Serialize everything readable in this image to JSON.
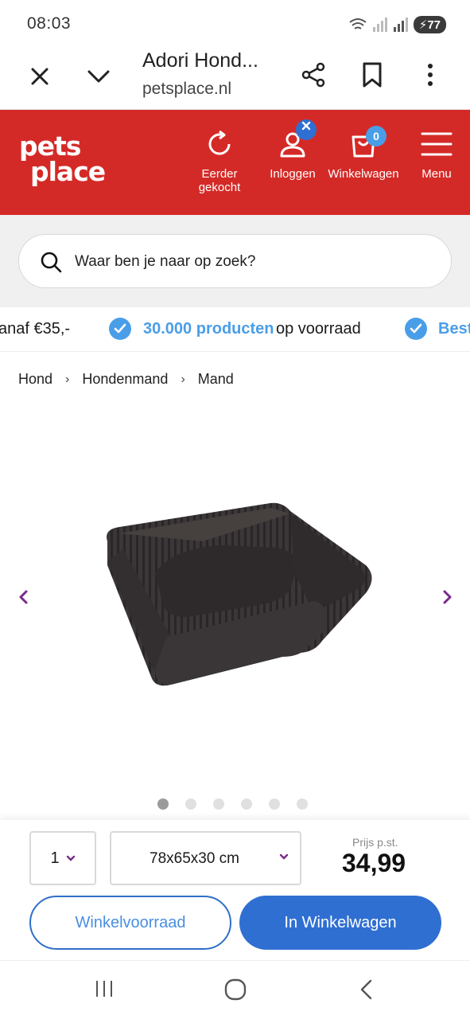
{
  "status_bar": {
    "time": "08:03",
    "battery": "77"
  },
  "browser": {
    "title": "Adori Hond...",
    "url": "petsplace.nl",
    "icons": [
      "close-icon",
      "chevron-down-icon",
      "share-icon",
      "bookmark-icon",
      "more-vertical-icon"
    ]
  },
  "header": {
    "logo_line1": "pets",
    "logo_line2": "place",
    "items": [
      {
        "label": "Eerder gekocht",
        "icon": "refresh-icon"
      },
      {
        "label": "Inloggen",
        "icon": "user-icon"
      },
      {
        "label": "Winkelwagen",
        "icon": "cart-icon"
      },
      {
        "label": "Menu",
        "icon": "hamburger-icon"
      }
    ],
    "cart_count": "0",
    "colors": {
      "brand": "#d42a27",
      "accent": "#4a9ee8"
    }
  },
  "search": {
    "placeholder": "Waar ben je naar op zoek?"
  },
  "usp": {
    "item1_tail": "anaf €35,-",
    "item2_highlight": "30.000 producten",
    "item2_rest": "op voorraad",
    "item3_partial": "Best"
  },
  "breadcrumb": [
    "Hond",
    "Hondenmand",
    "Mand"
  ],
  "gallery": {
    "image_count": 6,
    "active_index": 0
  },
  "purchase": {
    "quantity": "1",
    "size": "78x65x30 cm",
    "price_label": "Prijs p.st.",
    "price": "34,99",
    "stock_button": "Winkelvoorraad",
    "cart_button": "In Winkelwagen"
  }
}
